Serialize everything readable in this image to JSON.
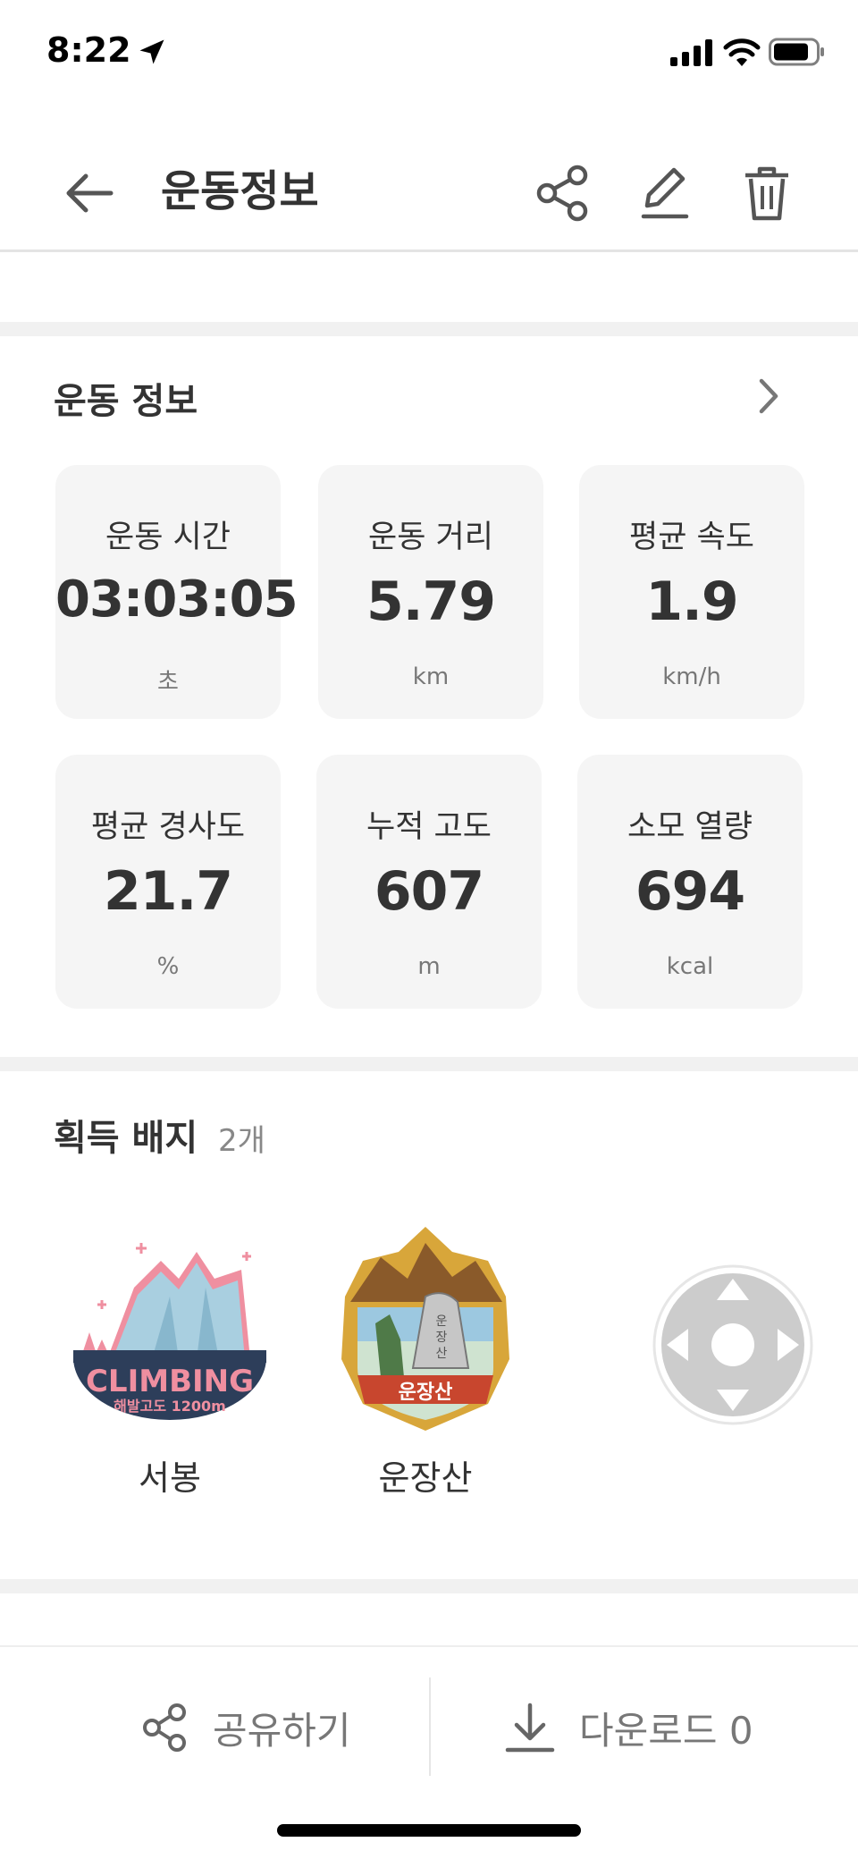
{
  "status_bar": {
    "time": "8:22"
  },
  "header": {
    "title": "운동정보"
  },
  "workout_section": {
    "title": "운동 정보",
    "stats": [
      {
        "label": "운동 시간",
        "value": "03:03:05",
        "unit": "초"
      },
      {
        "label": "운동 거리",
        "value": "5.79",
        "unit": "km"
      },
      {
        "label": "평균 속도",
        "value": "1.9",
        "unit": "km/h"
      },
      {
        "label": "평균 경사도",
        "value": "21.7",
        "unit": "%"
      },
      {
        "label": "누적 고도",
        "value": "607",
        "unit": "m"
      },
      {
        "label": "소모 열량",
        "value": "694",
        "unit": "kcal"
      }
    ]
  },
  "badges_section": {
    "title": "획득 배지",
    "count": "2개",
    "badges": [
      {
        "name": "서봉",
        "art_text_main": "CLIMBING",
        "art_text_sub": "해발고도 1200m",
        "icon": "climbing-badge-icon"
      },
      {
        "name": "운장산",
        "art_text_main": "운장산",
        "art_text_sign": "운장산",
        "icon": "mountain-stone-badge-icon"
      }
    ]
  },
  "bottom_bar": {
    "share_label": "공유하기",
    "download_label": "다운로드 0"
  },
  "colors": {
    "card_bg": "#f5f5f5",
    "divider": "#f1f1f1",
    "text": "#333333",
    "muted": "#777777"
  }
}
